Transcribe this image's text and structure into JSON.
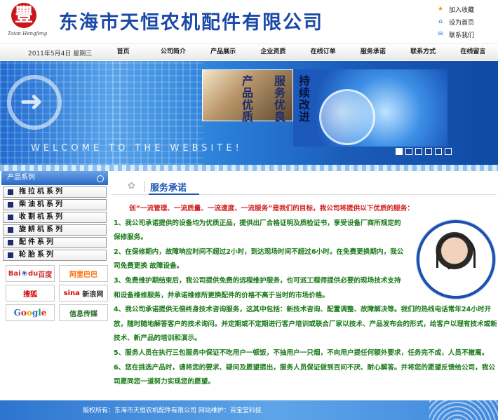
{
  "header": {
    "logo_char": "豐",
    "logo_text": "Taian Hengfeng",
    "company_name": "东海市天恒农机配件有限公司",
    "quick_links": [
      {
        "label": "加入收藏",
        "icon": "star-folder-icon"
      },
      {
        "label": "设为首页",
        "icon": "home-page-icon"
      },
      {
        "label": "联系我们",
        "icon": "mail-contact-icon"
      }
    ]
  },
  "nav": {
    "date": "2011年5月4日  星期三",
    "items": [
      "首页",
      "公司简介",
      "产品展示",
      "企业资质",
      "在线订单",
      "服务承诺",
      "联系方式",
      "在线留言"
    ]
  },
  "banner": {
    "slogan_col1": "产品优质",
    "slogan_col2": "服务优良",
    "slogan_col3": "持续改进",
    "welcome": "WELCOME TO THE WEBSITE!",
    "slide_count": 6,
    "active_slide": 1
  },
  "sidebar": {
    "title": "产品系列",
    "categories": [
      "拖拉机系列",
      "柴油机系列",
      "收割机系列",
      "旋耕机系列",
      "配件系列",
      "轮胎系列"
    ],
    "partners": [
      {
        "name": "baidu-logo",
        "text": "Bai",
        "text2": "du",
        "text3": "百度"
      },
      {
        "name": "alibaba-logo",
        "text": "阿里巴巴"
      },
      {
        "name": "sohu-logo",
        "text": "搜狐"
      },
      {
        "name": "sina-logo",
        "text": "sina",
        "text2": "新浪网"
      },
      {
        "name": "google-logo",
        "text": "Google"
      },
      {
        "name": "xinxi-logo",
        "text": "信息传媒"
      }
    ]
  },
  "main": {
    "title": "服务承诺",
    "intro": "创“一流管理、一流质量、一流速度、一流服务”是我们的目标，我公司将提供以下优质的服务：",
    "paragraphs": [
      "1、我公司承诺提供的设备均为优质正品，提供出厂合格证明及质检证书，享受设备厂商所规定的保修服务。",
      "2、在保修期内，故障响应时间不超过2小时，到达现场时间不超过6小时。在免费更换期内，我公司免费更换 故障设备。",
      "3、免费维护期结束后，我公司提供免费的远程维护服务，也可派工程师提供必要的现场技术支持和设备维修服务，并承诺维修所更换配件的价格不高于当时的市场价格。",
      "4、我公司承诺提供无偿终身技术咨询服务，这其中包括：新技术咨询、配置调整、故障解决等。我们的热线电话常年24小时开放，随时随地解答客户的技术询问。并定期或不定期进行客户培训或联合厂家以技术、产品发布会的形式，给客户以理有技术或新技术、新产品的培训和演示。",
      "5、服务人员在执行三包服务中保证不吃用户一顿饭，不抽用户一只烟，不向用户提任何额外要求，任务完不成，人员不撤离。",
      "6、您在挑选产品时，请将您的要求、疑问及愿望提出，服务人员保证做到百问不厌、耐心解答。并将您的愿望反馈给公司，我公司愿同您一道努力实现您的愿望。"
    ]
  },
  "footer": {
    "text": "版权所有：东海市天恒农机配件有限公司  网站维护：百宝堂科技"
  },
  "colors": {
    "brand_blue": "#1a49a8",
    "accent_red": "#d21e1e",
    "content_green": "#1a7a1a",
    "footer_blue": "#3f88dc"
  }
}
